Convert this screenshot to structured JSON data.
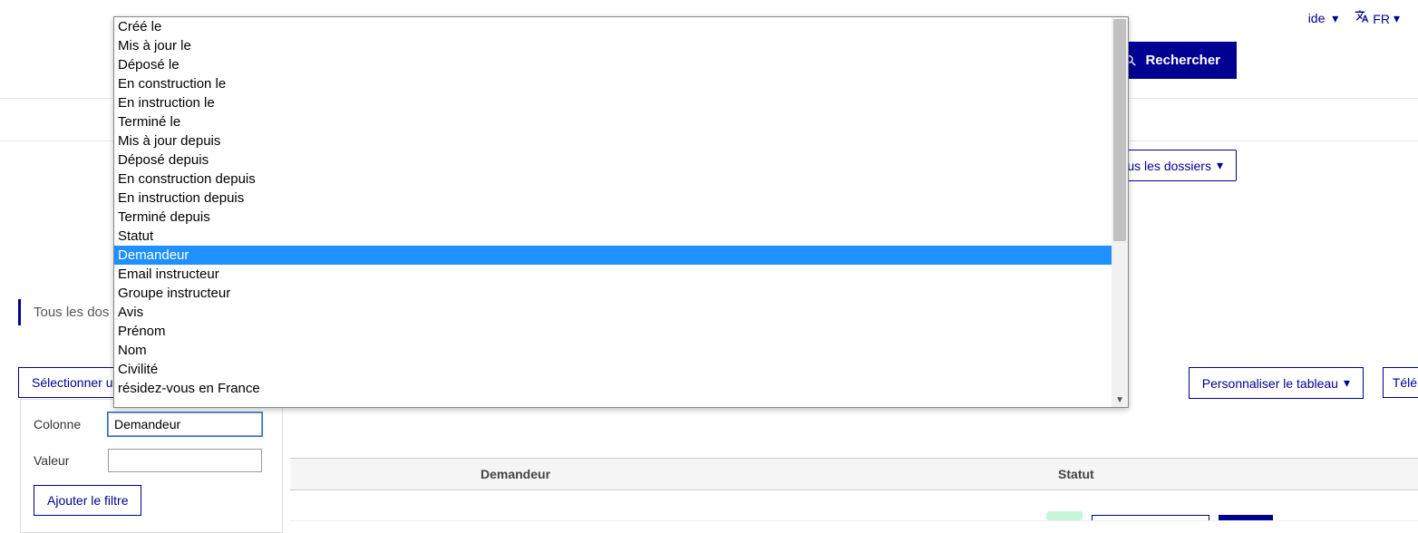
{
  "header": {
    "help_label": "ide",
    "lang_label": "FR",
    "search_label": "Rechercher"
  },
  "dossiers_button": "ous les dossiers",
  "tab": {
    "all_label": "Tous les dos"
  },
  "filter": {
    "select_button": "Sélectionner un",
    "col_label": "Colonne",
    "col_value": "Demandeur",
    "val_label": "Valeur",
    "val_value": "",
    "add_button": "Ajouter le filtre"
  },
  "actions": {
    "personalize": "Personnaliser le tableau",
    "download": "Télé"
  },
  "table": {
    "headers": {
      "demandeur": "Demandeur",
      "statut": "Statut"
    }
  },
  "dropdown": {
    "options": [
      "Créé le",
      "Mis à jour le",
      "Déposé le",
      "En construction le",
      "En instruction le",
      "Terminé le",
      "Mis à jour depuis",
      "Déposé depuis",
      "En construction depuis",
      "En instruction depuis",
      "Terminé depuis",
      "Statut",
      "Demandeur",
      "Email instructeur",
      "Groupe instructeur",
      "Avis",
      "Prénom",
      "Nom",
      "Civilité",
      "résidez-vous en France"
    ],
    "selected_index": 12
  }
}
